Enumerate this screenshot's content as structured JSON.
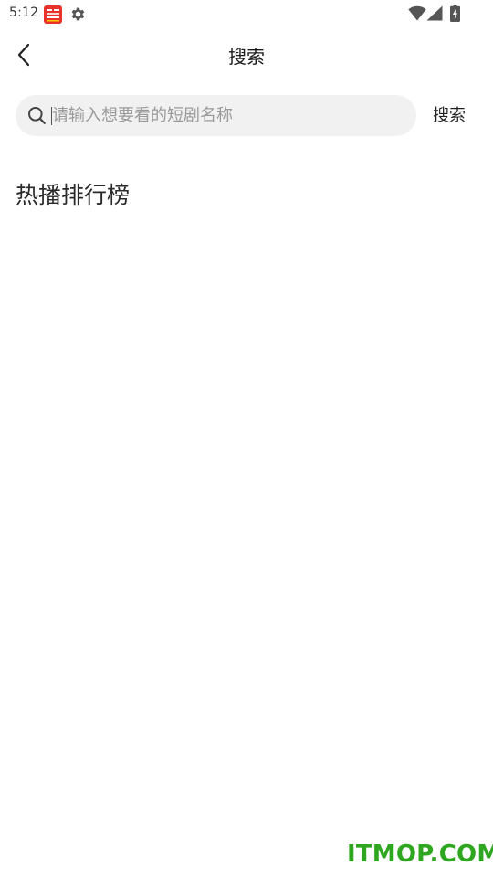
{
  "status_bar": {
    "time": "5:12",
    "icons": [
      "app-notification-icon",
      "settings-gear-icon",
      "wifi-icon",
      "cellular-signal-icon",
      "battery-charging-icon"
    ],
    "app_icon_color": "#e8322a"
  },
  "header": {
    "title": "搜索",
    "back_icon": "chevron-left-icon"
  },
  "search": {
    "placeholder": "请输入想要看的短剧名称",
    "value": "",
    "button_label": "搜索",
    "icon": "search-icon",
    "background": "#f1f1f1"
  },
  "sections": {
    "hot_ranking_title": "热播排行榜"
  },
  "watermark": {
    "text": "ITMOP.COM",
    "color": "#2fa61f"
  }
}
